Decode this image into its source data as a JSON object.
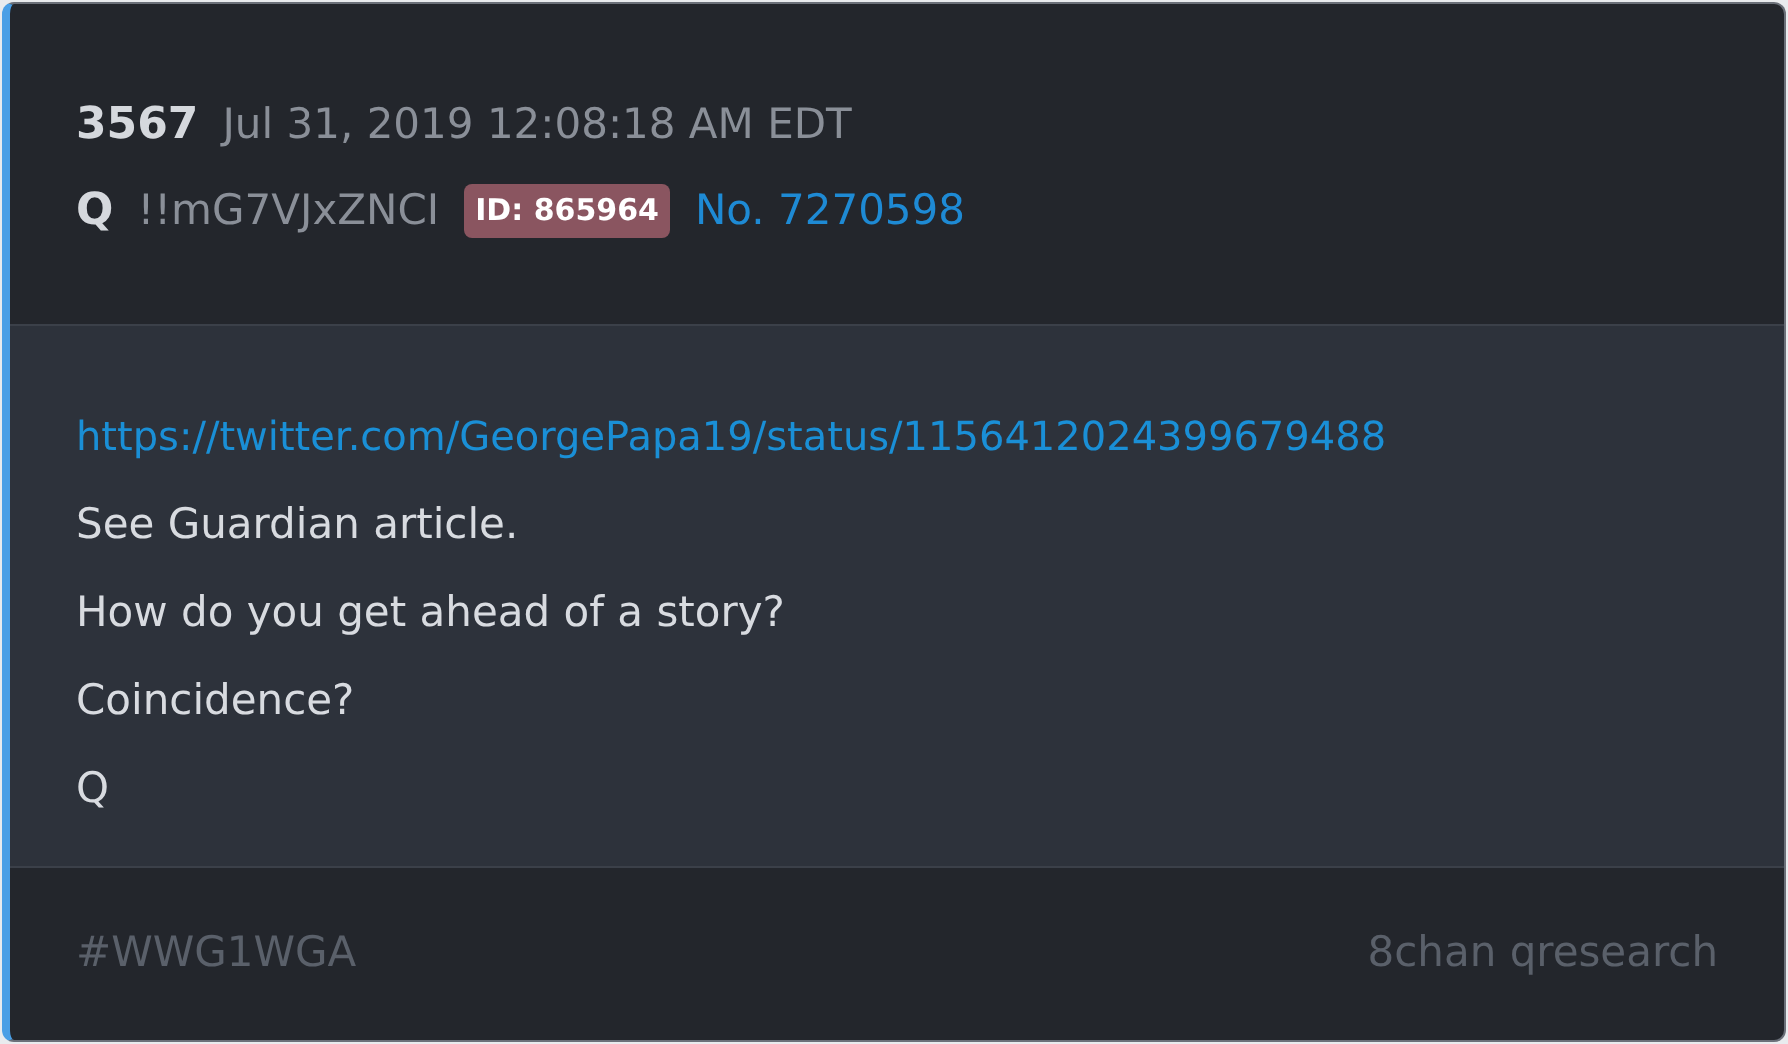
{
  "post": {
    "number": "3567",
    "date": "Jul 31, 2019 12:08:18 AM EDT",
    "author": "Q",
    "tripcode": "!!mG7VJxZNCI",
    "id_badge": "ID: 865964",
    "post_link": "No. 7270598"
  },
  "body": [
    {
      "kind": "link",
      "text": "https://twitter.com/GeorgePapa19/status/1156412024399679488"
    },
    {
      "kind": "text",
      "text": "See Guardian article."
    },
    {
      "kind": "text",
      "text": "How do you get ahead of a story?"
    },
    {
      "kind": "text",
      "text": "Coincidence?"
    },
    {
      "kind": "text",
      "text": "Q"
    }
  ],
  "footer": {
    "tag": "#WWG1WGA",
    "source": "8chan qresearch"
  }
}
